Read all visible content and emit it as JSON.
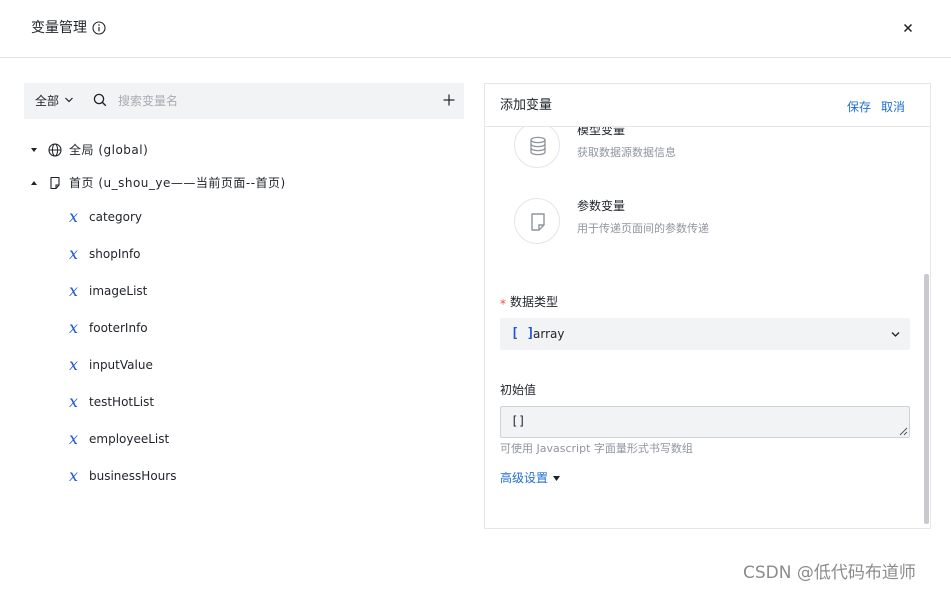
{
  "header": {
    "title": "变量管理"
  },
  "left": {
    "scope_label": "全部",
    "search_placeholder": "搜索变量名",
    "tree": {
      "global_label": "全局 (global)",
      "page_label": "首页 (u_shou_ye——当前页面--首页)",
      "variables": [
        "category",
        "shopInfo",
        "imageList",
        "footerInfo",
        "inputValue",
        "testHotList",
        "employeeList",
        "businessHours"
      ]
    }
  },
  "panel": {
    "title": "添加变量",
    "save_label": "保存",
    "cancel_label": "取消",
    "options": [
      {
        "title": "模型变量",
        "desc": "获取数据源数据信息",
        "icon": "database-icon"
      },
      {
        "title": "参数变量",
        "desc": "用于传递页面间的参数传递",
        "icon": "document-icon"
      }
    ],
    "data_type": {
      "required_mark": "*",
      "label": "数据类型",
      "icon_text": "[ ]",
      "value": "array"
    },
    "initial_value": {
      "label": "初始值",
      "value": "[]",
      "hint": "可使用 Javascript 字面量形式书写数组"
    },
    "advanced_label": "高级设置"
  },
  "watermark": "CSDN @低代码布道师",
  "colors": {
    "accent": "#1f6fd1",
    "icon_blue": "#1f54d6",
    "required": "#f54a45",
    "input_bg": "#f2f3f5"
  }
}
